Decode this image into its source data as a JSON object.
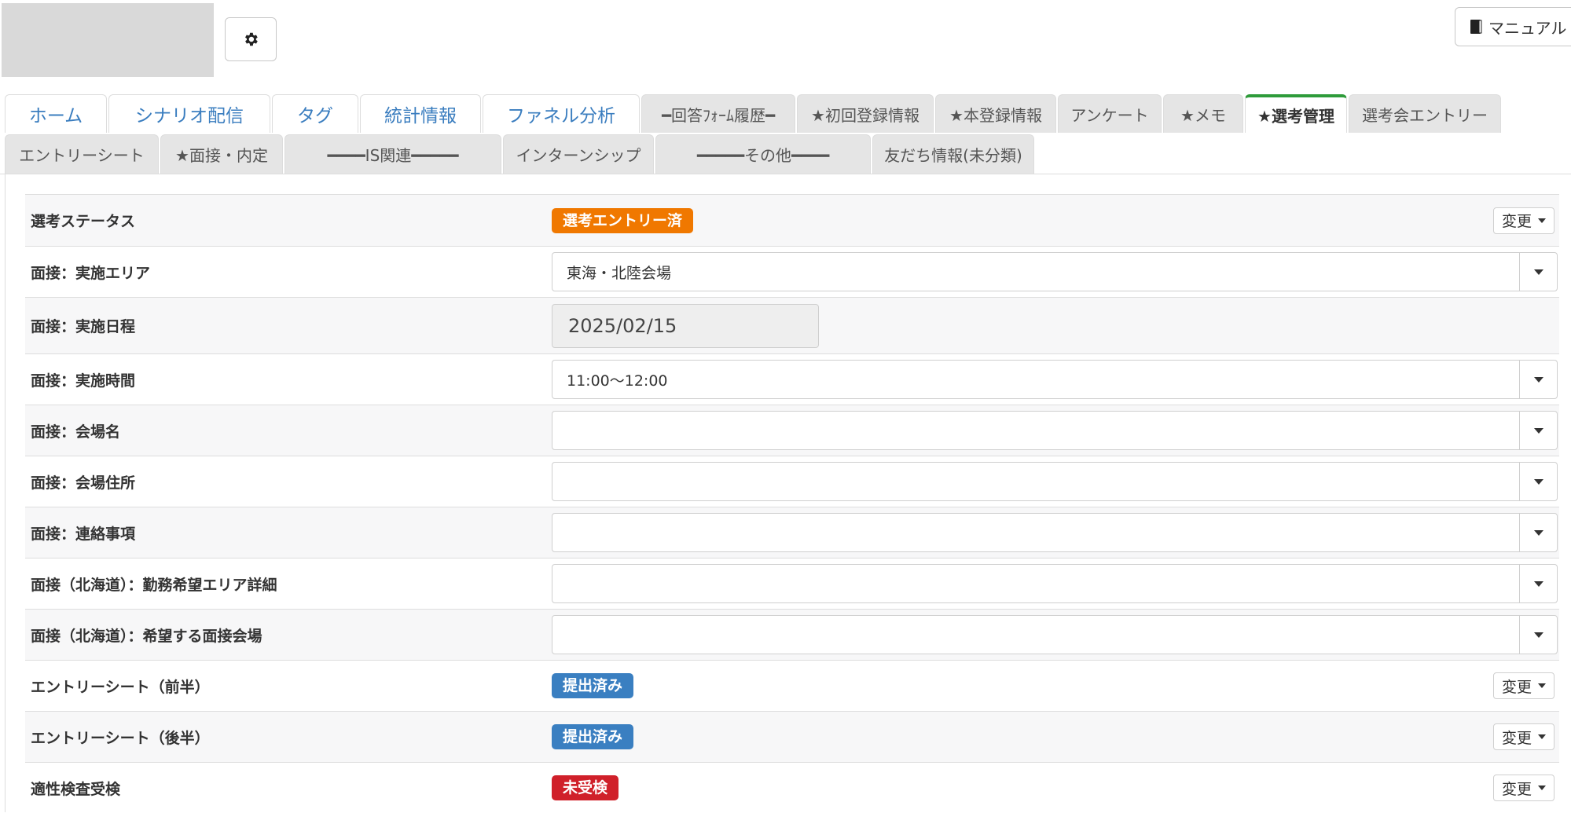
{
  "header": {
    "gear_icon": "gear-icon",
    "manual_label": "マニュアル",
    "manual_icon": "book-icon"
  },
  "tabs_row1": [
    {
      "label": "ホーム",
      "kind": "main"
    },
    {
      "label": "シナリオ配信",
      "kind": "main"
    },
    {
      "label": "タグ",
      "kind": "main"
    },
    {
      "label": "統計情報",
      "kind": "main"
    },
    {
      "label": "ファネル分析",
      "kind": "main"
    },
    {
      "label": "━回答ﾌｫｰﾑ履歴━",
      "kind": "sub"
    },
    {
      "label": "★初回登録情報",
      "kind": "sub"
    },
    {
      "label": "★本登録情報",
      "kind": "sub"
    },
    {
      "label": "アンケート",
      "kind": "sub"
    },
    {
      "label": "★メモ",
      "kind": "sub"
    },
    {
      "label": "★選考管理",
      "kind": "active"
    },
    {
      "label": "選考会エントリー",
      "kind": "sub"
    }
  ],
  "tabs_row2": [
    {
      "label": "エントリーシート",
      "kind": "sub"
    },
    {
      "label": "★面接・内定",
      "kind": "sub"
    },
    {
      "label": "━━━━IS関連━━━━━",
      "kind": "sub"
    },
    {
      "label": "インターンシップ",
      "kind": "sub"
    },
    {
      "label": "━━━━━その他━━━━",
      "kind": "sub"
    },
    {
      "label": "友だち情報(未分類)",
      "kind": "sub"
    }
  ],
  "fields": [
    {
      "label": "選考ステータス",
      "type": "badge",
      "value": "選考エントリー済",
      "color": "orange",
      "change_label": "変更"
    },
    {
      "label": "面接：実施エリア",
      "type": "select",
      "value": "東海・北陸会場"
    },
    {
      "label": "面接：実施日程",
      "type": "date",
      "value": "2025/02/15"
    },
    {
      "label": "面接：実施時間",
      "type": "select",
      "value": "11:00〜12:00"
    },
    {
      "label": "面接：会場名",
      "type": "select",
      "value": ""
    },
    {
      "label": "面接：会場住所",
      "type": "select",
      "value": ""
    },
    {
      "label": "面接：連絡事項",
      "type": "select",
      "value": ""
    },
    {
      "label": "面接（北海道）：勤務希望エリア詳細",
      "type": "select",
      "value": ""
    },
    {
      "label": "面接（北海道）：希望する面接会場",
      "type": "select",
      "value": ""
    },
    {
      "label": "エントリーシート（前半）",
      "type": "badge",
      "value": "提出済み",
      "color": "blue",
      "change_label": "変更"
    },
    {
      "label": "エントリーシート（後半）",
      "type": "badge",
      "value": "提出済み",
      "color": "blue",
      "change_label": "変更"
    },
    {
      "label": "適性検査受検",
      "type": "badge",
      "value": "未受検",
      "color": "red",
      "change_label": "変更"
    }
  ],
  "colors": {
    "active_tab_border": "#2e9b3a",
    "link": "#3a7dbf",
    "badge_orange": "#f07800",
    "badge_blue": "#3a7fc1",
    "badge_red": "#d0202a"
  }
}
